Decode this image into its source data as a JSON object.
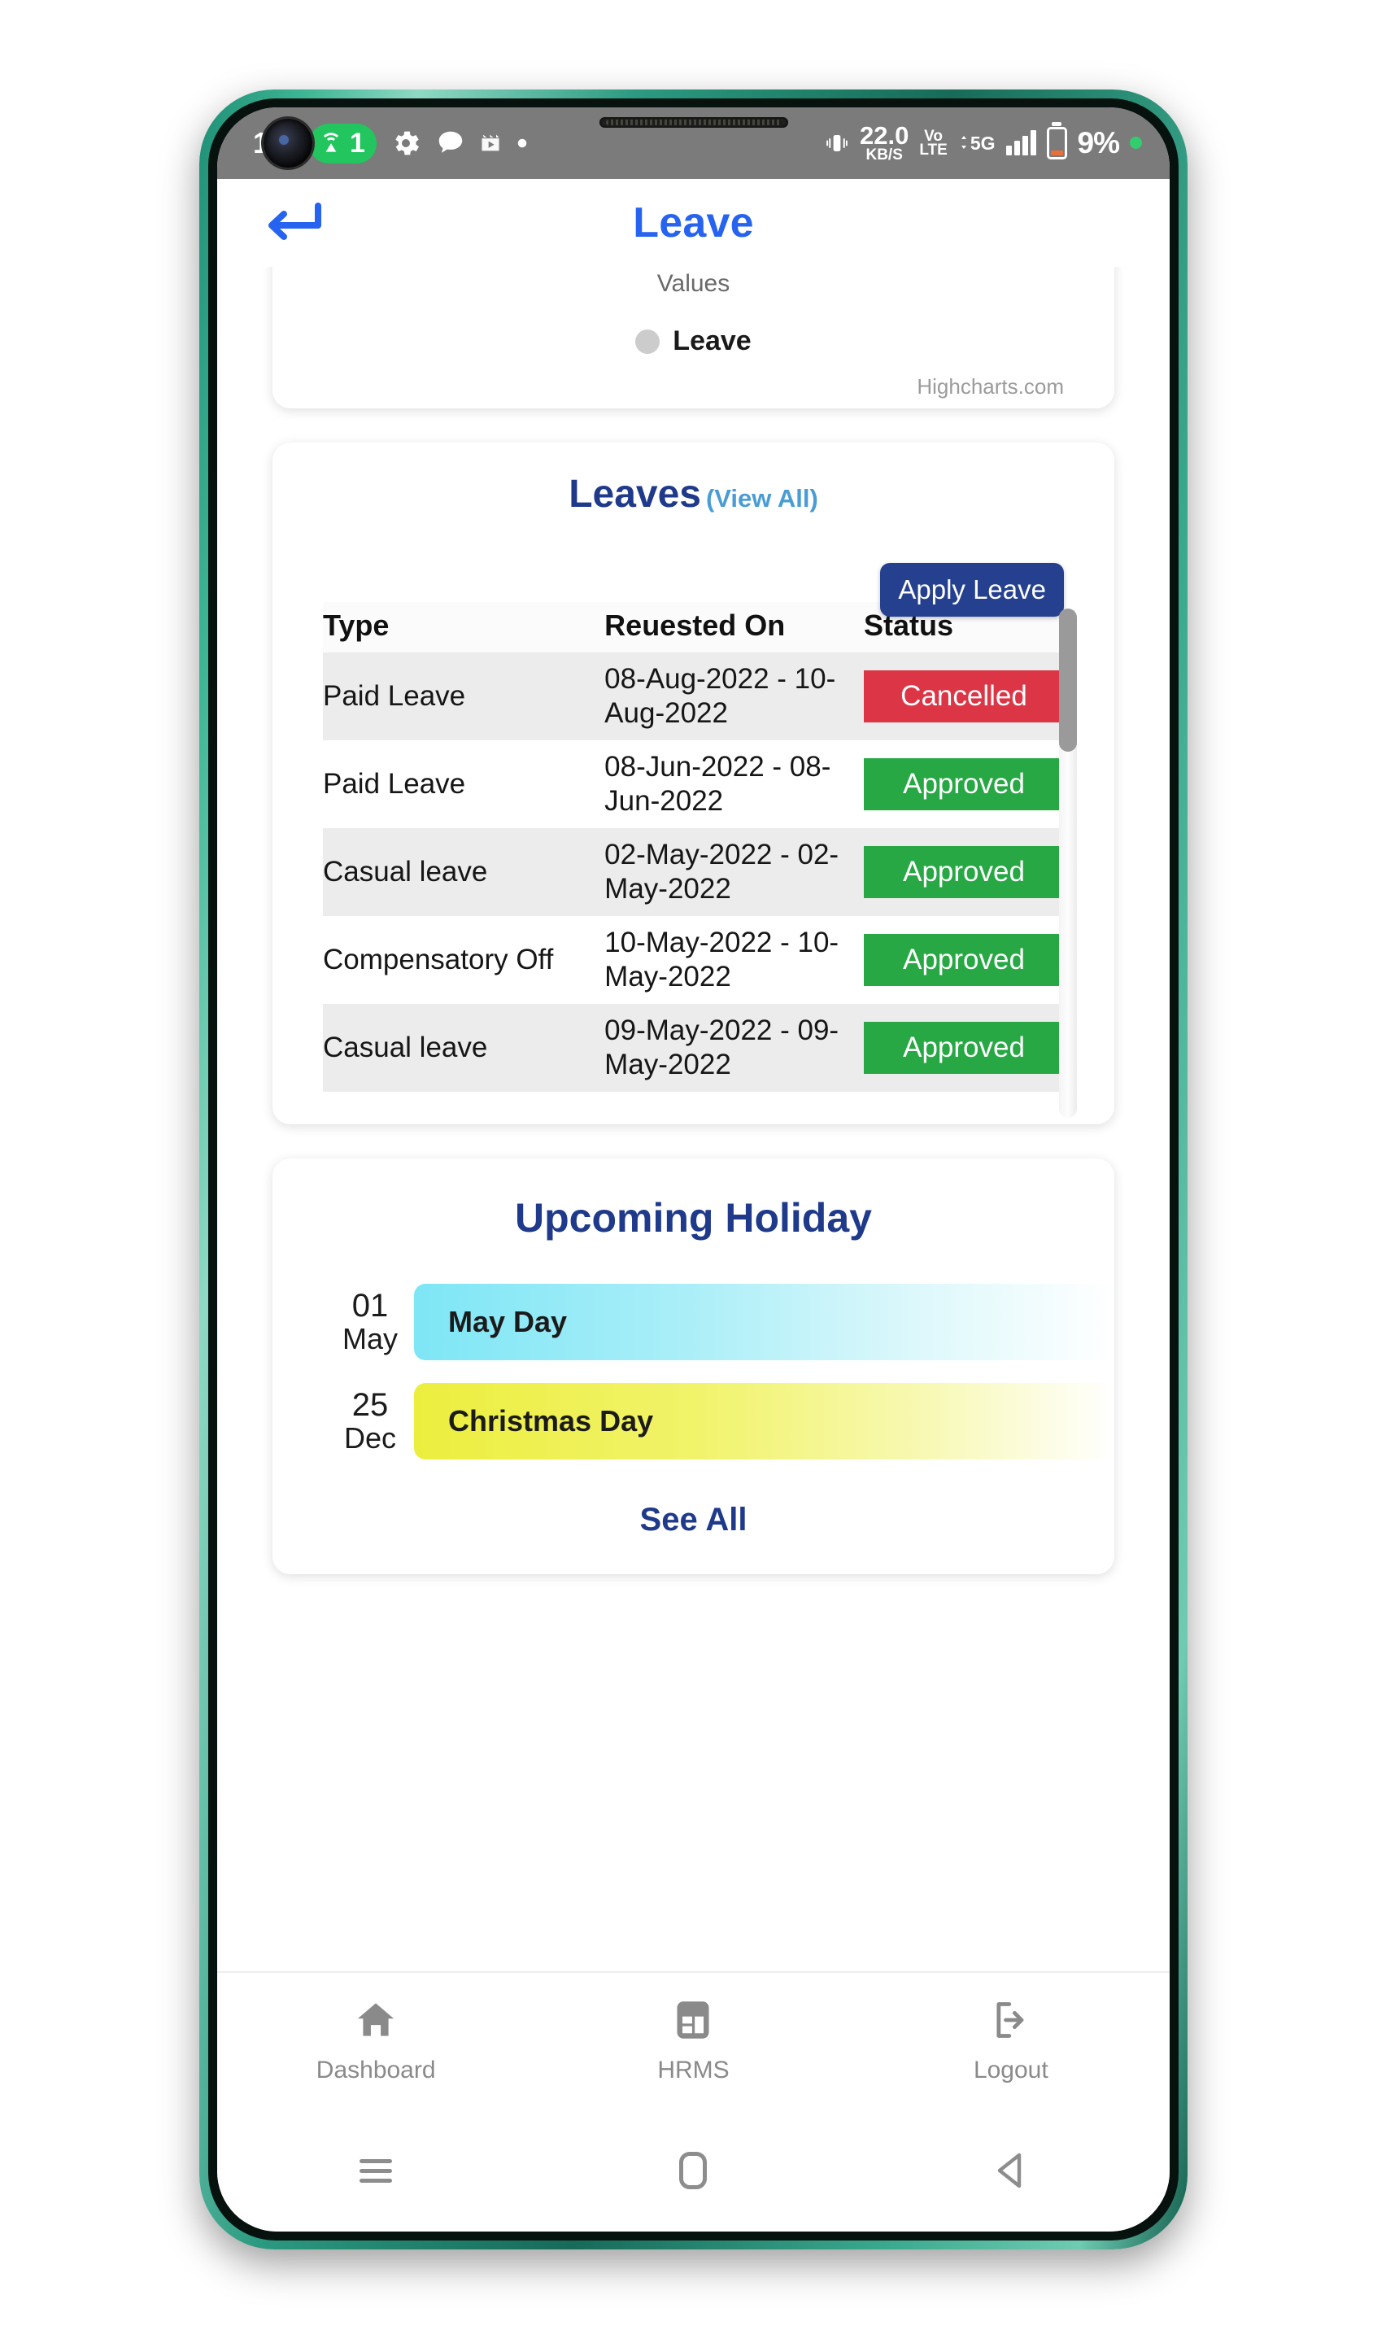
{
  "status_bar": {
    "left_number": "1",
    "icons": [
      "camera-punch-hole",
      "hotspot-icon",
      "gear-icon",
      "chat-icon",
      "media-icon",
      "dot-icon"
    ],
    "hotspot_count": "1",
    "net_speed_value": "22.0",
    "net_speed_unit": "KB/S",
    "volte_top": "Vo",
    "volte_bottom": "LTE",
    "network": "5G",
    "battery_percent": "9%"
  },
  "header": {
    "title": "Leave",
    "back_icon": "back-arrow-icon"
  },
  "chart_card": {
    "axis_label": "Values",
    "legend_label": "Leave",
    "credit": "Highcharts.com"
  },
  "chart_data": {
    "type": "line",
    "title": "Leave",
    "xlabel": "",
    "ylabel": "Values",
    "series": [
      {
        "name": "Leave",
        "values": []
      }
    ],
    "legend": [
      "Leave"
    ],
    "legend_position": "bottom",
    "credit": "Highcharts.com",
    "note": "Chart is scrolled out of view; only the axis label, legend and credit are visible."
  },
  "leaves_card": {
    "title": "Leaves",
    "view_all": "(View All)",
    "apply_button": "Apply Leave",
    "columns": [
      "Type",
      "Reuested On",
      "Status"
    ],
    "rows": [
      {
        "type": "Paid Leave",
        "requested_on": "08-Aug-2022 - 10-Aug-2022",
        "status": "Cancelled"
      },
      {
        "type": "Paid Leave",
        "requested_on": "08-Jun-2022 - 08-Jun-2022",
        "status": "Approved"
      },
      {
        "type": "Casual leave",
        "requested_on": "02-May-2022 - 02-May-2022",
        "status": "Approved"
      },
      {
        "type": "Compensatory Off",
        "requested_on": "10-May-2022 - 10-May-2022",
        "status": "Approved"
      },
      {
        "type": "Casual leave",
        "requested_on": "09-May-2022 - 09-May-2022",
        "status": "Approved"
      }
    ],
    "status_colors": {
      "Approved": "#27a844",
      "Cancelled": "#dc3545"
    }
  },
  "holiday_card": {
    "title": "Upcoming Holiday",
    "items": [
      {
        "day": "01",
        "month": "May",
        "name": "May Day",
        "color": "#7ee6f5"
      },
      {
        "day": "25",
        "month": "Dec",
        "name": "Christmas Day",
        "color": "#ecee3e"
      }
    ],
    "see_all": "See All"
  },
  "bottom_nav": {
    "items": [
      {
        "label": "Dashboard",
        "icon": "home-icon"
      },
      {
        "label": "HRMS",
        "icon": "dashboard-grid-icon"
      },
      {
        "label": "Logout",
        "icon": "logout-icon"
      }
    ]
  },
  "android_nav": {
    "recents": "recents-icon",
    "home": "home-square-icon",
    "back": "back-triangle-icon"
  }
}
